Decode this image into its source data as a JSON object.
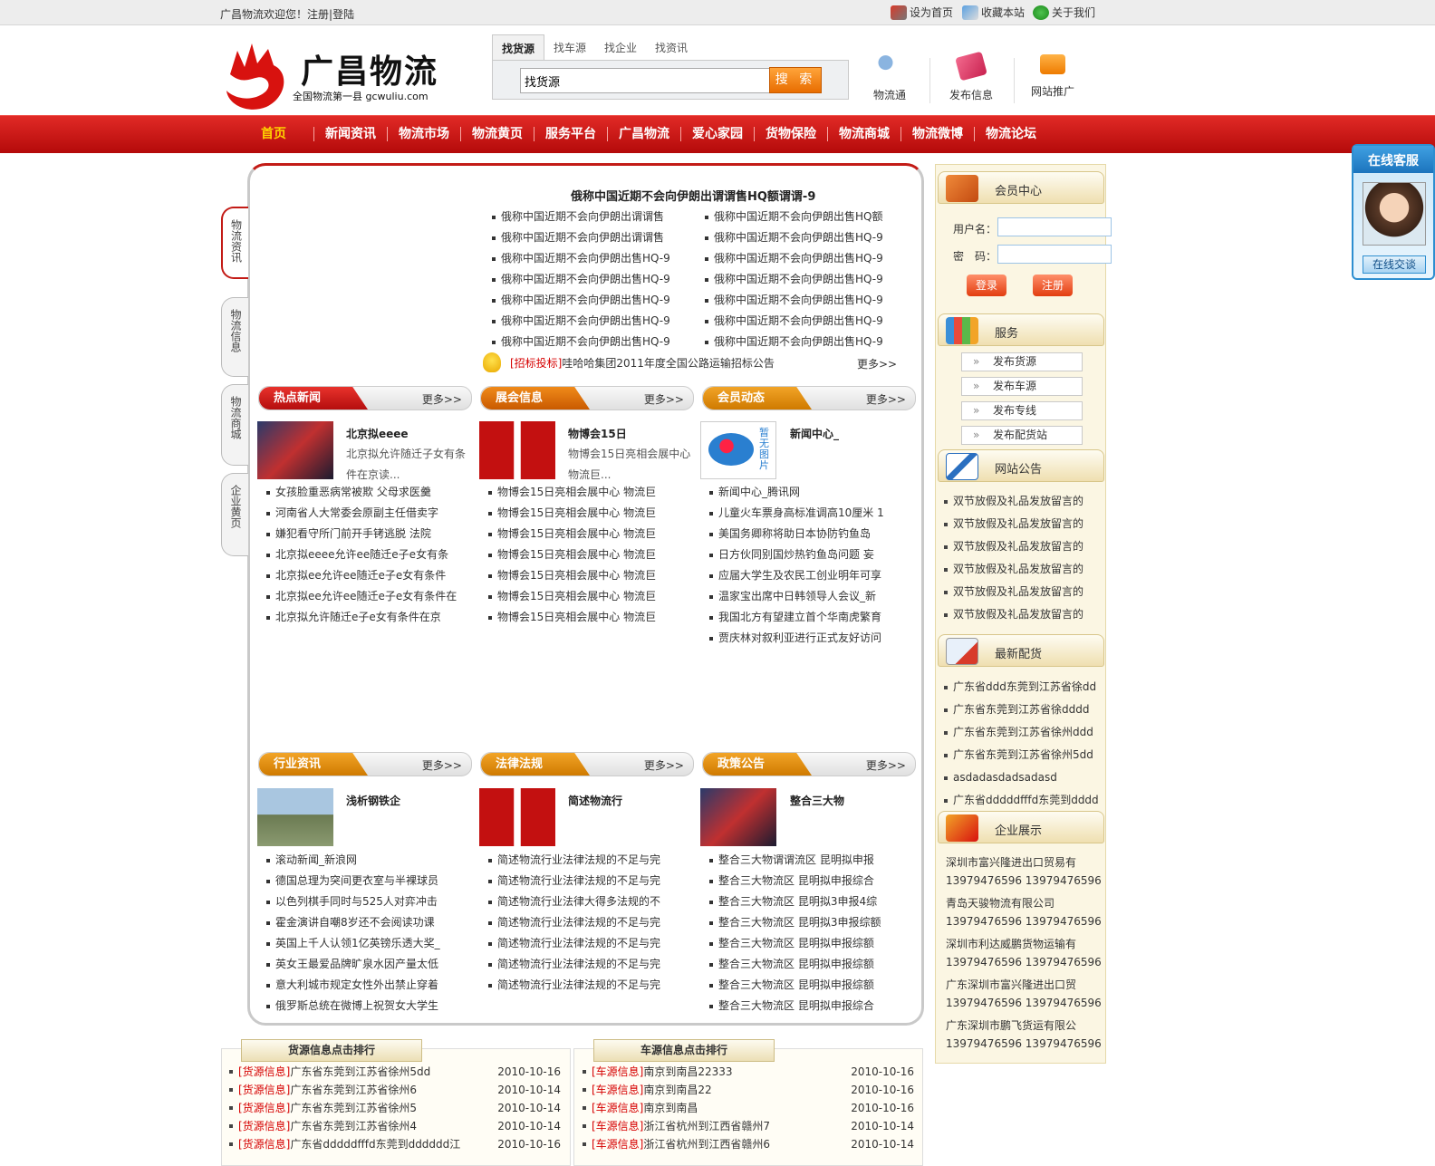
{
  "topbar": {
    "welcome": "广昌物流欢迎您！",
    "register": "注册",
    "login": "登陆",
    "set_home": "设为首页",
    "bookmark": "收藏本站",
    "about": "关于我们"
  },
  "logo": {
    "title": "广昌物流",
    "subtitle": "全国物流第一县 gcwuliu.com"
  },
  "search": {
    "tabs": [
      "找货源",
      "找车源",
      "找企业",
      "找资讯"
    ],
    "value": "找货源",
    "button": "搜 索"
  },
  "quick": [
    {
      "label": "物流通",
      "icon": "people-icon"
    },
    {
      "label": "发布信息",
      "icon": "cards-icon"
    },
    {
      "label": "网站推广",
      "icon": "promo-icon"
    }
  ],
  "nav": [
    "首页",
    "新闻资讯",
    "物流市场",
    "物流黄页",
    "服务平台",
    "广昌物流",
    "爱心家园",
    "货物保险",
    "物流商城",
    "物流微博",
    "物流论坛"
  ],
  "sidetabs": [
    "物流资讯",
    "物流信息",
    "物流商城",
    "企业黄页"
  ],
  "headline": "俄称中国近期不会向伊朗出谓谓售HQ额谓谓-9",
  "news_left": [
    "俄称中国近期不会向伊朗出谓谓售",
    "俄称中国近期不会向伊朗出谓谓售",
    "俄称中国近期不会向伊朗出售HQ-9",
    "俄称中国近期不会向伊朗出售HQ-9",
    "俄称中国近期不会向伊朗出售HQ-9",
    "俄称中国近期不会向伊朗出售HQ-9",
    "俄称中国近期不会向伊朗出售HQ-9"
  ],
  "news_right": [
    "俄称中国近期不会向伊朗出售HQ额",
    "俄称中国近期不会向伊朗出售HQ-9",
    "俄称中国近期不会向伊朗出售HQ-9",
    "俄称中国近期不会向伊朗出售HQ-9",
    "俄称中国近期不会向伊朗出售HQ-9",
    "俄称中国近期不会向伊朗出售HQ-9",
    "俄称中国近期不会向伊朗出售HQ-9"
  ],
  "tender": {
    "tag": "[招标投标]",
    "text": "哇哈哈集团2011年度全国公路运输招标公告",
    "more": "更多>>"
  },
  "sections_top": [
    {
      "title": "热点新闻",
      "more": "更多>>",
      "feat_title": "北京拟eeee",
      "feat_desc": "北京拟允许随迁子女有条件在京读...",
      "items": [
        "女孩脸重恶病常被欺 父母求医羹",
        "河南省人大常委会原副主任借卖字",
        "嫌犯看守所门前开手铐逃脱 法院",
        "北京拟eeee允许ee随迁e子e女有条",
        "北京拟ee允许ee随迁e子e女有条件",
        "北京拟ee允许ee随迁e子e女有条件在",
        "北京拟允许随迁e子e女有条件在京"
      ]
    },
    {
      "title": "展会信息",
      "more": "更多>>",
      "feat_title": "物博会15日",
      "feat_desc": "物博会15日亮相会展中心物流巨...",
      "items": [
        "物博会15日亮相会展中心 物流巨",
        "物博会15日亮相会展中心 物流巨",
        "物博会15日亮相会展中心 物流巨",
        "物博会15日亮相会展中心 物流巨",
        "物博会15日亮相会展中心 物流巨",
        "物博会15日亮相会展中心 物流巨",
        "物博会15日亮相会展中心 物流巨"
      ]
    },
    {
      "title": "会员动态",
      "more": "更多>>",
      "feat_title": "新闻中心_",
      "feat_desc": "",
      "noimg": "暂无图片",
      "items": [
        "新闻中心_腾讯网",
        "儿童火车票身高标准调高10厘米 1",
        "美国务卿称将助日本协防钓鱼岛",
        "日方伙同别国炒热钓鱼岛问题 妄",
        "应届大学生及农民工创业明年可享",
        "温家宝出席中日韩领导人会议_新",
        "我国北方有望建立首个华南虎繁育",
        "贾庆林对叙利亚进行正式友好访问"
      ]
    }
  ],
  "sections_bottom": [
    {
      "title": "行业资讯",
      "more": "更多>>",
      "feat_title": "浅析钢铁企",
      "items": [
        "滚动新闻_新浪网",
        "德国总理为突间更衣室与半裸球员",
        "以色列棋手同时与525人对弈冲击",
        "霍金演讲自嘲8岁还不会阅读功课",
        "英国上千人认领1亿英镑乐透大奖_",
        "英女王最爱品牌旷泉水因产量太低",
        "意大利城市规定女性外出禁止穿着",
        "俄罗斯总统在微博上祝贺女大学生"
      ]
    },
    {
      "title": "法律法规",
      "more": "更多>>",
      "feat_title": "简述物流行",
      "items": [
        "简述物流行业法律法规的不足与完",
        "简述物流行业法律法规的不足与完",
        "简述物流行业法律大得多法规的不",
        "简述物流行业法律法规的不足与完",
        "简述物流行业法律法规的不足与完",
        "简述物流行业法律法规的不足与完",
        "简述物流行业法律法规的不足与完"
      ]
    },
    {
      "title": "政策公告",
      "more": "更多>>",
      "feat_title": "整合三大物",
      "items": [
        "整合三大物谓谓流区 昆明拟申报",
        "整合三大物流区 昆明拟申报综合",
        "整合三大物流区 昆明拟3申报4综",
        "整合三大物流区 昆明拟3申报综额",
        "整合三大物流区 昆明拟申报综额",
        "整合三大物流区 昆明拟申报综额",
        "整合三大物流区 昆明拟申报综额",
        "整合三大物流区 昆明拟申报综合"
      ]
    }
  ],
  "member": {
    "title": "会员中心",
    "username_label": "用户名：",
    "password_label": "密　码：",
    "login": "登录",
    "register": "注册"
  },
  "services": {
    "title": "服务",
    "items": [
      "发布货源",
      "发布车源",
      "发布专线",
      "发布配货站"
    ]
  },
  "notice": {
    "title": "网站公告",
    "items": [
      "双节放假及礼品发放留言的",
      "双节放假及礼品发放留言的",
      "双节放假及礼品发放留言的",
      "双节放假及礼品发放留言的",
      "双节放假及礼品发放留言的",
      "双节放假及礼品发放留言的"
    ]
  },
  "latest": {
    "title": "最新配货",
    "items": [
      "广东省ddd东莞到江苏省徐dd",
      "广东省东莞到江苏省徐dddd",
      "广东省东莞到江苏省徐州ddd",
      "广东省东莞到江苏省徐州5dd",
      "asdadasdadsadasd",
      "广东省dddddfffd东莞到dddd"
    ]
  },
  "companies": {
    "title": "企业展示",
    "items": [
      {
        "name": "深圳市富兴隆进出口贸易有",
        "phone": "13979476596 13979476596"
      },
      {
        "name": "青岛天骏物流有限公司",
        "phone": "13979476596 13979476596"
      },
      {
        "name": "深圳市利达威鹏货物运输有",
        "phone": "13979476596 13979476596"
      },
      {
        "name": "广东深圳市富兴隆进出口贸",
        "phone": "13979476596 13979476596"
      },
      {
        "name": "广东深圳市鹏飞货运有限公",
        "phone": "13979476596 13979476596"
      }
    ]
  },
  "kefu": {
    "title": "在线客服",
    "button": "在线交谈"
  },
  "rank_cargo": {
    "title": "货源信息点击排行",
    "items": [
      {
        "tag": "[货源信息]",
        "text": "广东省东莞到江苏省徐州5dd",
        "date": "2010-10-16"
      },
      {
        "tag": "[货源信息]",
        "text": "广东省东莞到江苏省徐州6",
        "date": "2010-10-14"
      },
      {
        "tag": "[货源信息]",
        "text": "广东省东莞到江苏省徐州5",
        "date": "2010-10-14"
      },
      {
        "tag": "[货源信息]",
        "text": "广东省东莞到江苏省徐州4",
        "date": "2010-10-14"
      },
      {
        "tag": "[货源信息]",
        "text": "广东省dddddfffd东莞到dddddd江",
        "date": "2010-10-16"
      }
    ]
  },
  "rank_truck": {
    "title": "车源信息点击排行",
    "items": [
      {
        "tag": "[车源信息]",
        "text": "南京到南昌22333",
        "date": "2010-10-16"
      },
      {
        "tag": "[车源信息]",
        "text": "南京到南昌22",
        "date": "2010-10-16"
      },
      {
        "tag": "[车源信息]",
        "text": "南京到南昌",
        "date": "2010-10-16"
      },
      {
        "tag": "[车源信息]",
        "text": "浙江省杭州到江西省赣州7",
        "date": "2010-10-14"
      },
      {
        "tag": "[车源信息]",
        "text": "浙江省杭州到江西省赣州6",
        "date": "2010-10-14"
      }
    ]
  },
  "colors": {
    "brand_red": "#c31b16",
    "nav_home": "#ffd200",
    "tag_red": "#d60000"
  }
}
